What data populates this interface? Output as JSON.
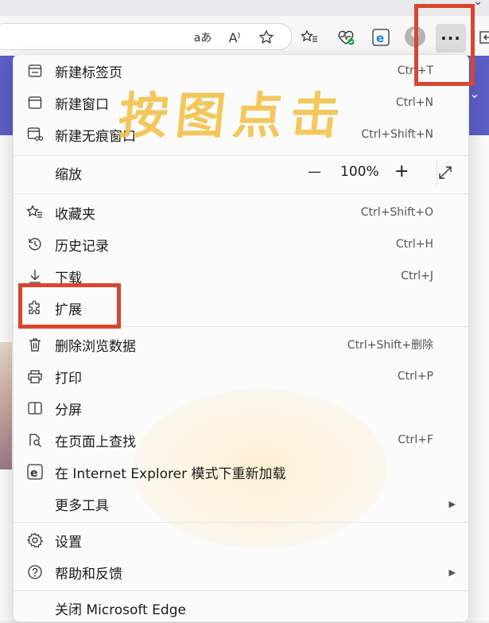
{
  "toolbar": {
    "icons": [
      "read-aloud-translate-icon",
      "read-aloud-icon",
      "favorite-star-icon",
      "favorites-icon",
      "browser-essentials-icon",
      "edge-ie-icon",
      "profile-icon"
    ],
    "more_label": "···"
  },
  "menu": {
    "items": [
      {
        "label": "新建标签页",
        "shortcut": "Ctrl+T",
        "icon": "new-tab-icon"
      },
      {
        "label": "新建窗口",
        "shortcut": "Ctrl+N",
        "icon": "new-window-icon"
      },
      {
        "label": "新建无痕窗口",
        "shortcut": "Ctrl+Shift+N",
        "icon": "inprivate-window-icon"
      },
      {
        "label": "缩放",
        "icon": ""
      },
      {
        "label": "收藏夹",
        "shortcut": "Ctrl+Shift+O",
        "icon": "favorites-icon"
      },
      {
        "label": "历史记录",
        "shortcut": "Ctrl+H",
        "icon": "history-icon"
      },
      {
        "label": "下载",
        "shortcut": "Ctrl+J",
        "icon": "download-icon"
      },
      {
        "label": "扩展",
        "shortcut": "",
        "icon": "extensions-icon"
      },
      {
        "label": "删除浏览数据",
        "shortcut": "Ctrl+Shift+删除",
        "icon": "delete-data-icon"
      },
      {
        "label": "打印",
        "shortcut": "Ctrl+P",
        "icon": "print-icon"
      },
      {
        "label": "分屏",
        "shortcut": "",
        "icon": "split-screen-icon"
      },
      {
        "label": "在页面上查找",
        "shortcut": "Ctrl+F",
        "icon": "find-icon"
      },
      {
        "label": "在 Internet Explorer 模式下重新加载",
        "shortcut": "",
        "icon": "ie-mode-icon"
      },
      {
        "label": "更多工具",
        "shortcut": "",
        "icon": ""
      },
      {
        "label": "设置",
        "shortcut": "",
        "icon": "settings-icon"
      },
      {
        "label": "帮助和反馈",
        "shortcut": "",
        "icon": "help-icon"
      },
      {
        "label": "关闭 Microsoft Edge",
        "shortcut": "",
        "icon": ""
      }
    ],
    "zoom": {
      "minus": "—",
      "value": "100%",
      "plus": "+"
    }
  },
  "annotation": {
    "text": "按图点击",
    "color": "#f3c24a",
    "box_color": "#d9452f"
  }
}
